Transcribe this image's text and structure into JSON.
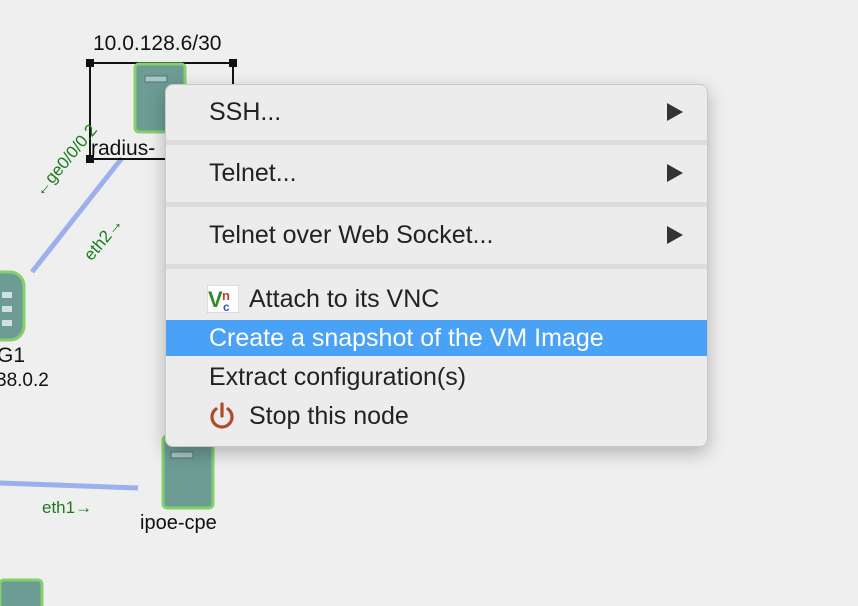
{
  "canvas": {
    "top_node_address": "10.0.128.6/30",
    "top_node_name": "radius-",
    "left_node_name": "G1",
    "left_node_address": "38.0.2",
    "bottom_node_name": "ipoe-cpe",
    "link_label_top_left": "←ge0/0/0.2",
    "link_label_top_right": "eth2→",
    "link_label_bottom": "eth1→"
  },
  "context_menu": {
    "items": [
      {
        "label": "SSH...",
        "submenu": true
      },
      {
        "label": "Telnet...",
        "submenu": true
      },
      {
        "label": "Telnet over Web Socket...",
        "submenu": true
      },
      {
        "label": "Attach to its VNC",
        "icon": "vnc-icon"
      },
      {
        "label": "Create a snapshot of the VM Image",
        "selected": true
      },
      {
        "label": "Extract configuration(s)"
      },
      {
        "label": "Stop this node",
        "icon": "power-icon"
      }
    ]
  },
  "colors": {
    "menu_highlight": "#4aa2f6",
    "link_line": "#9db0ec",
    "node_fill": "#6d9c95",
    "node_border": "#84d16c",
    "interface_label": "#1b7a1b",
    "power_icon": "#b04a2a"
  }
}
